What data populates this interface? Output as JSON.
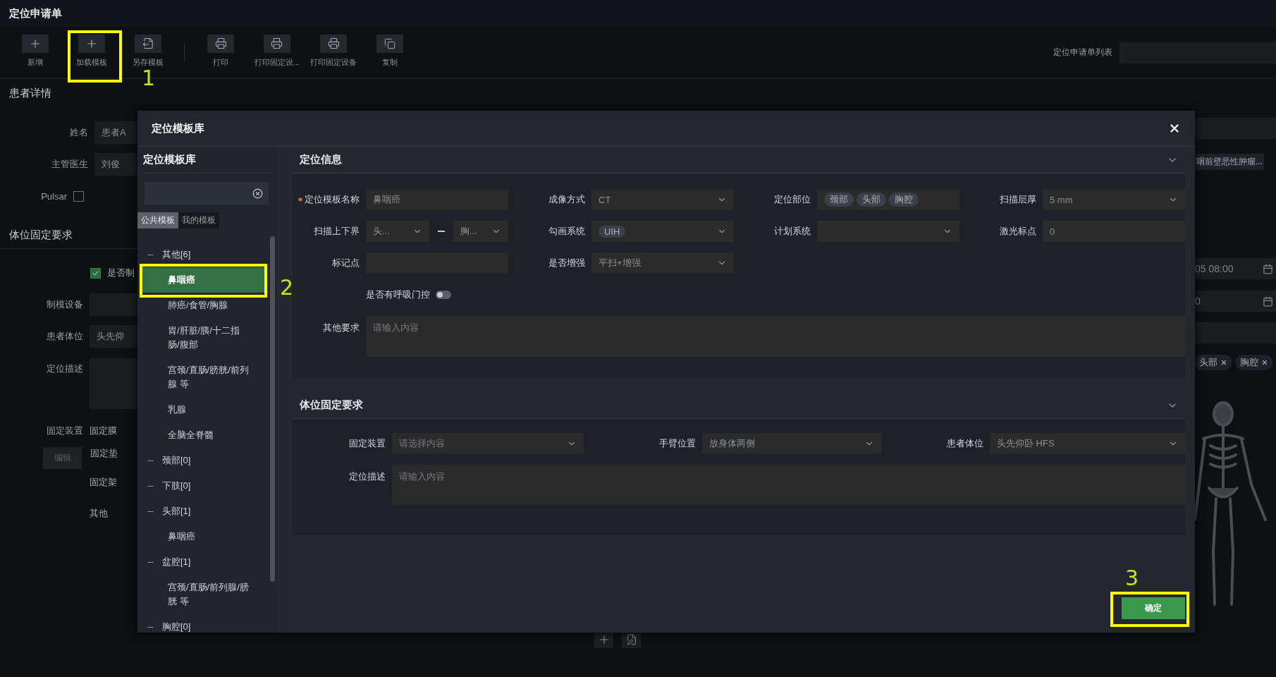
{
  "page": {
    "title": "定位申请单"
  },
  "toolbar": {
    "buttons": [
      {
        "kind": "plus",
        "label": "新增"
      },
      {
        "kind": "plus",
        "label": "加载模板"
      },
      {
        "kind": "saveas",
        "label": "另存模板"
      },
      {
        "kind": "print",
        "label": "打印"
      },
      {
        "kind": "print",
        "label": "打印固定设..."
      },
      {
        "kind": "print",
        "label": "打印固定设备"
      },
      {
        "kind": "copy",
        "label": "复制"
      }
    ],
    "list_label": "定位申请单列表"
  },
  "patient": {
    "title": "患者详情",
    "fields": [
      {
        "label": "姓名",
        "value": "患者A"
      },
      {
        "label": "主管医生",
        "value": "刘俊"
      }
    ],
    "pulsar": {
      "label": "Pulsar",
      "checked": false
    }
  },
  "fixation": {
    "title": "体位固定要求",
    "make_mold": {
      "label": "是否制",
      "checked": true
    },
    "fields": [
      {
        "kind": "input",
        "label": "制模设备"
      },
      {
        "kind": "input",
        "label": "患者体位",
        "value": "头先仰"
      },
      {
        "kind": "textarea",
        "label": "定位描述"
      }
    ],
    "devices": {
      "label": "固定装置",
      "edit_button": "编辑",
      "items": [
        "固定膜",
        "固定垫",
        "固定架",
        "其他"
      ]
    }
  },
  "side_panel": {
    "diagnosis": "咽前壁恶性肿瘤...",
    "dates": [
      {
        "value": "05 08:00"
      },
      {
        "value": "0"
      }
    ],
    "tags": [
      "头部",
      "胸腔"
    ]
  },
  "bottom_actions": [
    {
      "kind": "plus"
    },
    {
      "kind": "edit"
    }
  ],
  "dialog": {
    "title": "定位模板库",
    "library": {
      "title": "定位模板库",
      "tabs": [
        {
          "label": "公共模板",
          "selected": true
        },
        {
          "label": "我的模板",
          "selected": false
        }
      ],
      "tree": [
        {
          "label": "其他[6]",
          "expanded": true,
          "children": [
            {
              "label": "鼻咽癌",
              "selected": true
            },
            {
              "label": "肺癌/食管/胸腺",
              "selected": false
            },
            {
              "label": "胃/肝脏/胰/十二指肠/腹部",
              "selected": false
            },
            {
              "label": "宫颈/直肠/膀胱/前列腺 等",
              "selected": false
            },
            {
              "label": "乳腺",
              "selected": false
            },
            {
              "label": "全脑全脊髓",
              "selected": false
            }
          ]
        },
        {
          "label": "颈部[0]",
          "expanded": true
        },
        {
          "label": "下肢[0]",
          "expanded": true
        },
        {
          "label": "头部[1]",
          "expanded": true,
          "children": [
            {
              "label": "鼻咽癌",
              "selected": false
            }
          ]
        },
        {
          "label": "盆腔[1]",
          "expanded": true,
          "children": [
            {
              "label": "宫颈/直肠/前列腺/膀胱 等",
              "selected": false
            }
          ]
        },
        {
          "label": "胸腔[0]",
          "expanded": true
        }
      ]
    },
    "info_section": {
      "title": "定位信息",
      "expanded": true,
      "fields": [
        {
          "kind": "text",
          "label": "定位模板名称",
          "required": true,
          "value": "鼻咽癌"
        },
        {
          "kind": "select",
          "label": "成像方式",
          "value": "CT"
        },
        {
          "kind": "tags",
          "label": "定位部位",
          "tags": [
            "颈部",
            "头部",
            "胸腔"
          ]
        },
        {
          "kind": "select",
          "label": "扫描层厚",
          "value": "5 mm"
        },
        {
          "kind": "range",
          "label": "扫描上下界",
          "from": "头...",
          "to": "胸..."
        },
        {
          "kind": "select",
          "label": "勾画系统",
          "tags": [
            "UIH"
          ]
        },
        {
          "kind": "select",
          "label": "计划系统"
        },
        {
          "kind": "text",
          "label": "激光标点",
          "value": "0"
        },
        {
          "kind": "text",
          "label": "标记点"
        },
        {
          "kind": "select",
          "label": "是否增强",
          "value": "平扫+增强"
        },
        {
          "kind": "toggle",
          "label": "是否有呼吸门控",
          "on": false
        },
        {
          "kind": "textarea",
          "label": "其他要求",
          "placeholder": "请输入内容"
        }
      ]
    },
    "fixation_section": {
      "title": "体位固定要求",
      "expanded": true,
      "fields": [
        {
          "kind": "select",
          "label": "固定装置",
          "placeholder": "请选择内容"
        },
        {
          "kind": "select",
          "label": "手臂位置",
          "value": "放身体两侧"
        },
        {
          "kind": "select",
          "label": "患者体位",
          "value": "头先仰卧 HFS"
        },
        {
          "kind": "textarea",
          "label": "定位描述",
          "placeholder": "请输入内容"
        }
      ]
    },
    "confirm_button": "确定"
  },
  "annotations": [
    {
      "label": "1"
    },
    {
      "label": "2"
    },
    {
      "label": "3"
    }
  ]
}
